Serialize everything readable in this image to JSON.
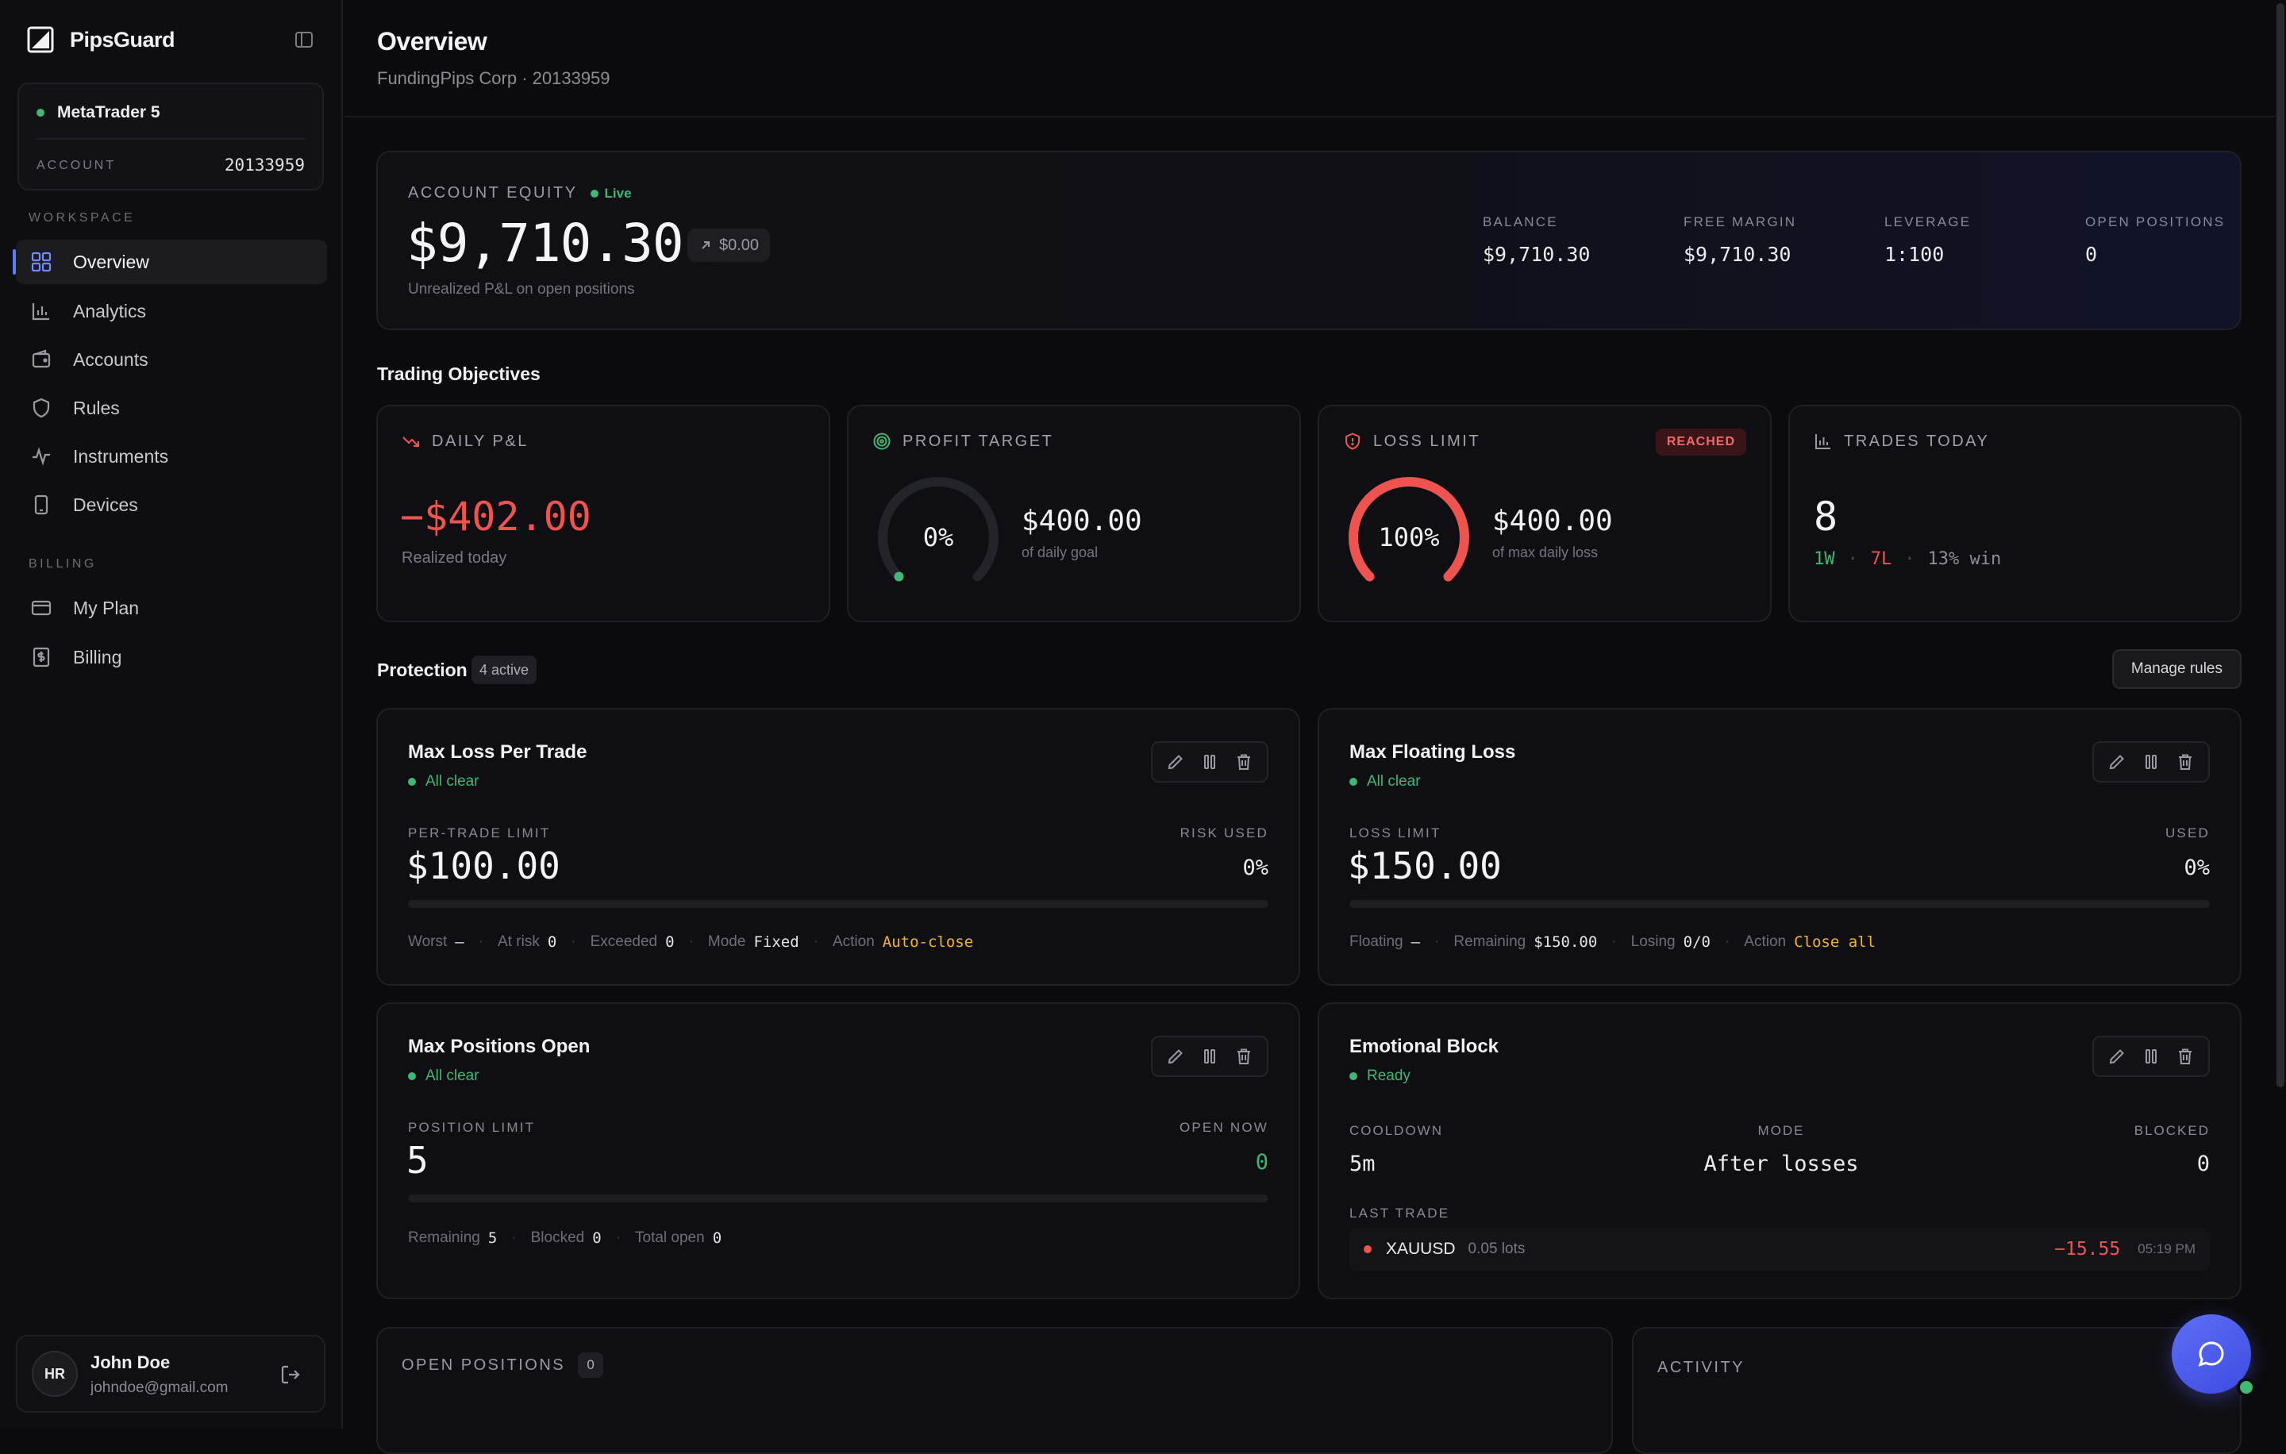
{
  "app": {
    "name": "PipsGuard"
  },
  "sidebar": {
    "platform": {
      "name": "MetaTrader 5",
      "account_label": "ACCOUNT",
      "account_number": "20133959"
    },
    "workspace_label": "WORKSPACE",
    "billing_label": "BILLING",
    "workspace_items": [
      {
        "label": "Overview",
        "icon": "grid-icon",
        "active": true
      },
      {
        "label": "Analytics",
        "icon": "bar-chart-icon"
      },
      {
        "label": "Accounts",
        "icon": "wallet-icon"
      },
      {
        "label": "Rules",
        "icon": "shield-icon"
      },
      {
        "label": "Instruments",
        "icon": "pulse-icon"
      },
      {
        "label": "Devices",
        "icon": "device-icon"
      }
    ],
    "billing_items": [
      {
        "label": "My Plan",
        "icon": "credit-card-icon"
      },
      {
        "label": "Billing",
        "icon": "receipt-icon"
      }
    ],
    "user": {
      "initials": "HR",
      "name": "John Doe",
      "email": "johndoe@gmail.com"
    }
  },
  "header": {
    "title": "Overview",
    "subtitle": "FundingPips Corp · 20133959"
  },
  "equity": {
    "label": "ACCOUNT EQUITY",
    "live_label": "Live",
    "value": "$9,710.30",
    "change": "$0.00",
    "note": "Unrealized P&L on open positions",
    "stats": [
      {
        "label": "BALANCE",
        "value": "$9,710.30"
      },
      {
        "label": "FREE MARGIN",
        "value": "$9,710.30"
      },
      {
        "label": "LEVERAGE",
        "value": "1:100"
      },
      {
        "label": "OPEN POSITIONS",
        "value": "0"
      }
    ]
  },
  "objectives": {
    "title": "Trading Objectives",
    "daily_pnl": {
      "label": "DAILY P&L",
      "value": "−$402.00",
      "note": "Realized today"
    },
    "profit_target": {
      "label": "PROFIT TARGET",
      "percent_label": "0%",
      "progress": 0,
      "amount": "$400.00",
      "note": "of daily goal"
    },
    "loss_limit": {
      "label": "LOSS LIMIT",
      "badge": "REACHED",
      "percent_label": "100%",
      "progress": 1,
      "amount": "$400.00",
      "note": "of max daily loss"
    },
    "trades_today": {
      "label": "TRADES TODAY",
      "count": "8",
      "wins": "1W",
      "losses": "7L",
      "win_rate": "13% win"
    }
  },
  "protection": {
    "title": "Protection",
    "active_chip": "4 active",
    "manage_label": "Manage rules",
    "rules": {
      "max_loss_per_trade": {
        "title": "Max Loss Per Trade",
        "status": "All clear",
        "left_label": "PER-TRADE LIMIT",
        "left_value": "$100.00",
        "right_label": "RISK USED",
        "right_value": "0%",
        "progress": 0,
        "footer": [
          {
            "k": "Worst",
            "v": "—"
          },
          {
            "k": "At risk",
            "v": "0"
          },
          {
            "k": "Exceeded",
            "v": "0"
          },
          {
            "k": "Mode",
            "v": "Fixed"
          },
          {
            "k": "Action",
            "v": "Auto-close"
          }
        ]
      },
      "max_floating_loss": {
        "title": "Max Floating Loss",
        "status": "All clear",
        "left_label": "LOSS LIMIT",
        "left_value": "$150.00",
        "right_label": "USED",
        "right_value": "0%",
        "progress": 0,
        "footer": [
          {
            "k": "Floating",
            "v": "—"
          },
          {
            "k": "Remaining",
            "v": "$150.00"
          },
          {
            "k": "Losing",
            "v": "0/0"
          },
          {
            "k": "Action",
            "v": "Close all"
          }
        ]
      },
      "max_positions_open": {
        "title": "Max Positions Open",
        "status": "All clear",
        "left_label": "POSITION LIMIT",
        "left_value": "5",
        "right_label": "OPEN NOW",
        "right_value": "0",
        "progress": 0,
        "footer": [
          {
            "k": "Remaining",
            "v": "5"
          },
          {
            "k": "Blocked",
            "v": "0"
          },
          {
            "k": "Total open",
            "v": "0"
          }
        ]
      },
      "emotional_block": {
        "title": "Emotional Block",
        "status": "Ready",
        "cooldown_label": "COOLDOWN",
        "cooldown_value": "5m",
        "mode_label": "MODE",
        "mode_value": "After losses",
        "blocked_label": "BLOCKED",
        "blocked_value": "0",
        "last_trade_label": "LAST TRADE",
        "last_trade": {
          "symbol": "XAUUSD",
          "lots": "0.05 lots",
          "pnl": "−15.55",
          "time": "05:19 PM"
        }
      }
    }
  },
  "bottom": {
    "open_positions_label": "OPEN POSITIONS",
    "open_positions_count": "0",
    "activity_label": "ACTIVITY"
  },
  "colors": {
    "accent": "#5b7cfa",
    "positive": "#3fb874",
    "negative": "#ef5350",
    "warning": "#f0b429"
  }
}
